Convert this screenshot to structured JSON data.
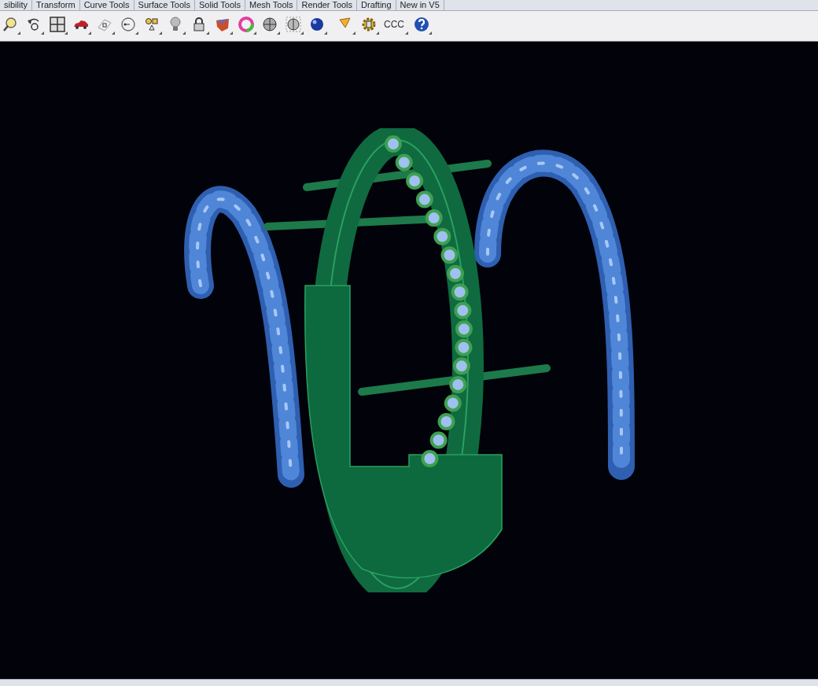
{
  "toolbar_tabs": [
    {
      "label": "sibility",
      "selected": false
    },
    {
      "label": "Transform",
      "selected": false
    },
    {
      "label": "Curve Tools",
      "selected": false
    },
    {
      "label": "Surface Tools",
      "selected": false
    },
    {
      "label": "Solid Tools",
      "selected": false
    },
    {
      "label": "Mesh Tools",
      "selected": false
    },
    {
      "label": "Render Tools",
      "selected": false
    },
    {
      "label": "Drafting",
      "selected": false
    },
    {
      "label": "New in V5",
      "selected": false
    }
  ],
  "toolbar": {
    "text_button": "CCC"
  }
}
